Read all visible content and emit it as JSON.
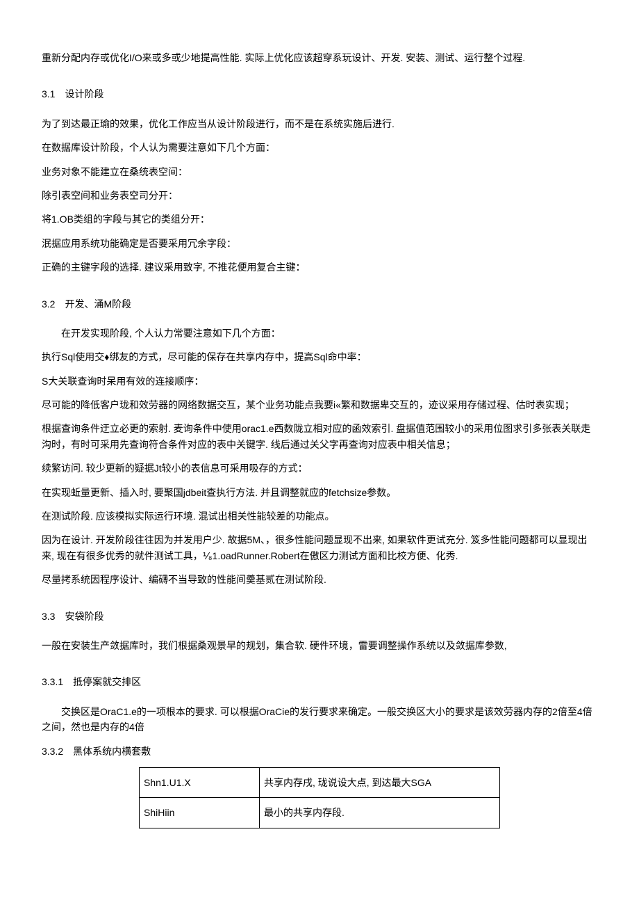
{
  "p1": "重新分配内存或优化I/O来或多或少地提高性能. 实际上优化应该超穿系玩设计、开发. 安装、测试、运行整个过程.",
  "s31_title": "3.1　设计阶段",
  "s31_p1": "为了到达最正瑜的效果，优化工作应当从设计阶段进行，而不是在系统实施后进行.",
  "s31_p2": "在数据库设计阶段，个人认为需要注意如下几个方面：",
  "s31_p3": "业务对象不能建立在桑统表空间：",
  "s31_p4": "除引表空间和业务表空司分开：",
  "s31_p5": "将1.OB类组的字段与其它的类组分开：",
  "s31_p6": "泯据应用系统功能确定是否要采用冗余字段：",
  "s31_p7": "正确的主键字段的选择. 建议采用致字, 不推花便用复合主键：",
  "s32_title": "3.2　开发、涌M阶段",
  "s32_p1": "在开发实现阶段, 个人认力常要注意如下几个方面：",
  "s32_p2": "执行Sql使用交♦绑友的方式，尽可能的保存在共享内存中，提高Sql命中率：",
  "s32_p3": "S大关联查询时呆用有效的连接顺序：",
  "s32_p4": "尽可能的降低客户珑和效劳器的网络数据交互，某个业务功能点我要i«繁和数据卑交互的，迹议采用存储过程、估时表实现；",
  "s32_p5": "根据查询条件迂立必更的索射. 麦询条件中使用orac1.e西数陇立相对应的函效索引. 盘据值范围较小的采用位图求引多张表关联走沟时，有时可采用先查询符合条件对应的表中关键字. 线后通过关父字再查询对应表中相关信息；",
  "s32_p6": "续繁访问. 较少更新的疑据Jt较小的表信息可采用吸存的方式：",
  "s32_p7": "在实现蚯量更新、插入时, 要聚国jdbeit查执行方法. 并且调整就应的fetchsize参数。",
  "s32_p8": "在测试阶段. 应该模拟实际运行环境. 混试出相关性能较差的功能点。",
  "s32_p9": "因为在设计. 开发阶段往往因为并发用户少. 故据5M、，很多性能问题显现不出来, 如果软件更试充分. 笈多性能问题都可以显现出来, 现在有很多优秀的就件测试工具，⅟₈1.oadRunner.Robert在傲区力测试方面和比校方便、化秀.",
  "s32_p10": "尽量拷系统因程序设计、编礴不当导致的性能间羹基贰在测试阶段.",
  "s33_title": "3.3　安袋阶段",
  "s33_p1": "一般在安装生产敛据库时，我们根据桑观景早的规划，集合软. 硬件环境，雷要调整操作系统以及敛据库参数,",
  "s331_title": "3.3.1　抵停案就交排区",
  "s331_p1": "交换区是OraC1.e的一项根本的要求. 可以根据OraCie的发行要求来确定。一般交换区大小的要求是该效劳器内存的2倍至4倍之间，然也是内存的4倍",
  "s332_title": "3.3.2　黑体系统内横套敷",
  "table": {
    "rows": [
      {
        "c1": "Shn1.U1.X",
        "c2": "共享内存戌, 珑说设大点, 到达最大SGA"
      },
      {
        "c1": "ShiHiin",
        "c2": "最小的共享内存段."
      }
    ]
  }
}
